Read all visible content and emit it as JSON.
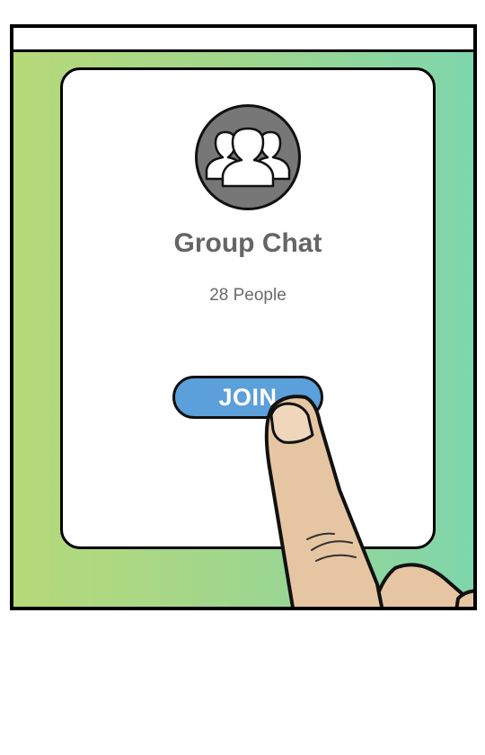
{
  "group": {
    "title": "Group Chat",
    "member_count_label": "28 People"
  },
  "actions": {
    "join_label": "JOIN"
  },
  "icons": {
    "avatar": "group-people-icon"
  },
  "colors": {
    "button_fill": "#5b9fdb",
    "avatar_fill": "#777777",
    "background_start": "#b7d979",
    "background_end": "#7fd6ad",
    "title_text": "#656565"
  }
}
